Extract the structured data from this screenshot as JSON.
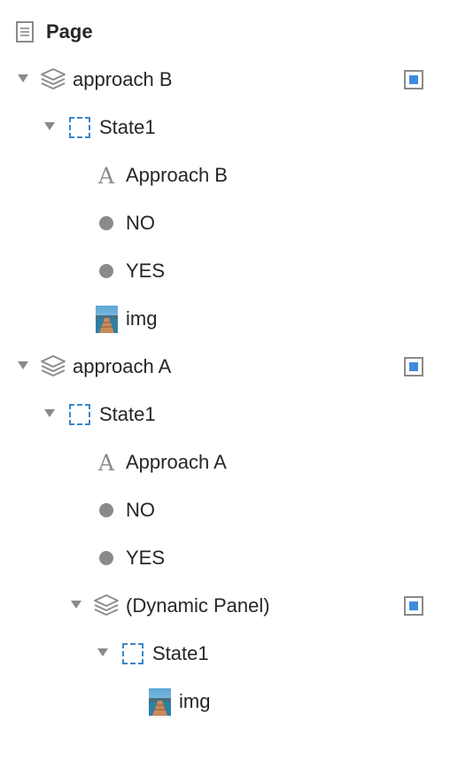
{
  "colors": {
    "text": "#262626",
    "icon_gray": "#8a8a8a",
    "state_dashed_blue": "#3d86c6",
    "toggle_fill_blue": "#3d8be0"
  },
  "page": {
    "label": "Page",
    "icon": "page-icon"
  },
  "tree": [
    {
      "kind": "dynamic-panel",
      "label": "approach B",
      "icon": "layers-icon",
      "expanded": true,
      "visibility_toggle": true,
      "children": [
        {
          "kind": "state",
          "label": "State1",
          "icon": "state-box-icon",
          "expanded": true,
          "children": [
            {
              "kind": "text",
              "label": "Approach B",
              "icon": "text-widget-icon"
            },
            {
              "kind": "shape",
              "label": "NO",
              "icon": "circle-shape-icon"
            },
            {
              "kind": "shape",
              "label": "YES",
              "icon": "circle-shape-icon"
            },
            {
              "kind": "image",
              "label": "img",
              "icon": "image-thumbnail-icon"
            }
          ]
        }
      ]
    },
    {
      "kind": "dynamic-panel",
      "label": "approach A",
      "icon": "layers-icon",
      "expanded": true,
      "visibility_toggle": true,
      "children": [
        {
          "kind": "state",
          "label": "State1",
          "icon": "state-box-icon",
          "expanded": true,
          "children": [
            {
              "kind": "text",
              "label": "Approach A",
              "icon": "text-widget-icon"
            },
            {
              "kind": "shape",
              "label": "NO",
              "icon": "circle-shape-icon"
            },
            {
              "kind": "shape",
              "label": "YES",
              "icon": "circle-shape-icon"
            },
            {
              "kind": "dynamic-panel",
              "label": "(Dynamic Panel)",
              "icon": "layers-icon",
              "expanded": true,
              "visibility_toggle": true,
              "children": [
                {
                  "kind": "state",
                  "label": "State1",
                  "icon": "state-box-icon",
                  "expanded": true,
                  "children": [
                    {
                      "kind": "image",
                      "label": "img",
                      "icon": "image-thumbnail-icon"
                    }
                  ]
                }
              ]
            }
          ]
        }
      ]
    }
  ]
}
